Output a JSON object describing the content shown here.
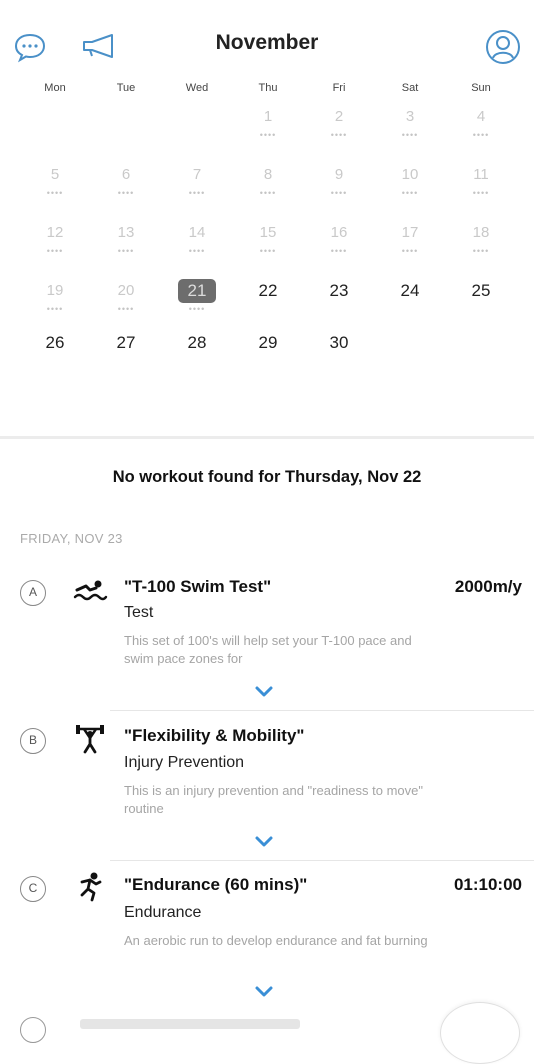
{
  "header": {
    "month": "November",
    "icons": {
      "chat": "chat-bubble-icon",
      "announce": "megaphone-icon",
      "profile": "profile-icon"
    },
    "accent_color": "#4a90c8"
  },
  "weekdays": [
    "Mon",
    "Tue",
    "Wed",
    "Thu",
    "Fri",
    "Sat",
    "Sun"
  ],
  "calendar": {
    "dots": "••••",
    "weeks": [
      [
        "",
        "",
        "",
        "1",
        "2",
        "3",
        "4"
      ],
      [
        "5",
        "6",
        "7",
        "8",
        "9",
        "10",
        "11"
      ],
      [
        "12",
        "13",
        "14",
        "15",
        "16",
        "17",
        "18"
      ],
      [
        "19",
        "20",
        "21",
        "22",
        "23",
        "24",
        "25"
      ],
      [
        "26",
        "27",
        "28",
        "29",
        "30",
        "",
        ""
      ]
    ],
    "today": "21"
  },
  "no_workout_message": "No workout found for Thursday, Nov 22",
  "section_date": "FRIDAY, NOV 23",
  "workouts": [
    {
      "badge": "A",
      "icon": "swim-icon",
      "title": "\"T-100 Swim Test\"",
      "value": "2000m/y",
      "subtitle": "Test",
      "description": "This set of 100's will help set your T-100 pace and swim pace zones for"
    },
    {
      "badge": "B",
      "icon": "strength-icon",
      "title": "\"Flexibility & Mobility\"",
      "value": "",
      "subtitle": "Injury Prevention",
      "description": "This is an injury prevention and \"readiness to move\" routine"
    },
    {
      "badge": "C",
      "icon": "run-icon",
      "title": "\"Endurance (60 mins)\"",
      "value": "01:10:00",
      "subtitle": "Endurance",
      "description": "An aerobic run to develop endurance and fat burning"
    }
  ],
  "icons": {
    "expand": "chevron-down-icon"
  }
}
